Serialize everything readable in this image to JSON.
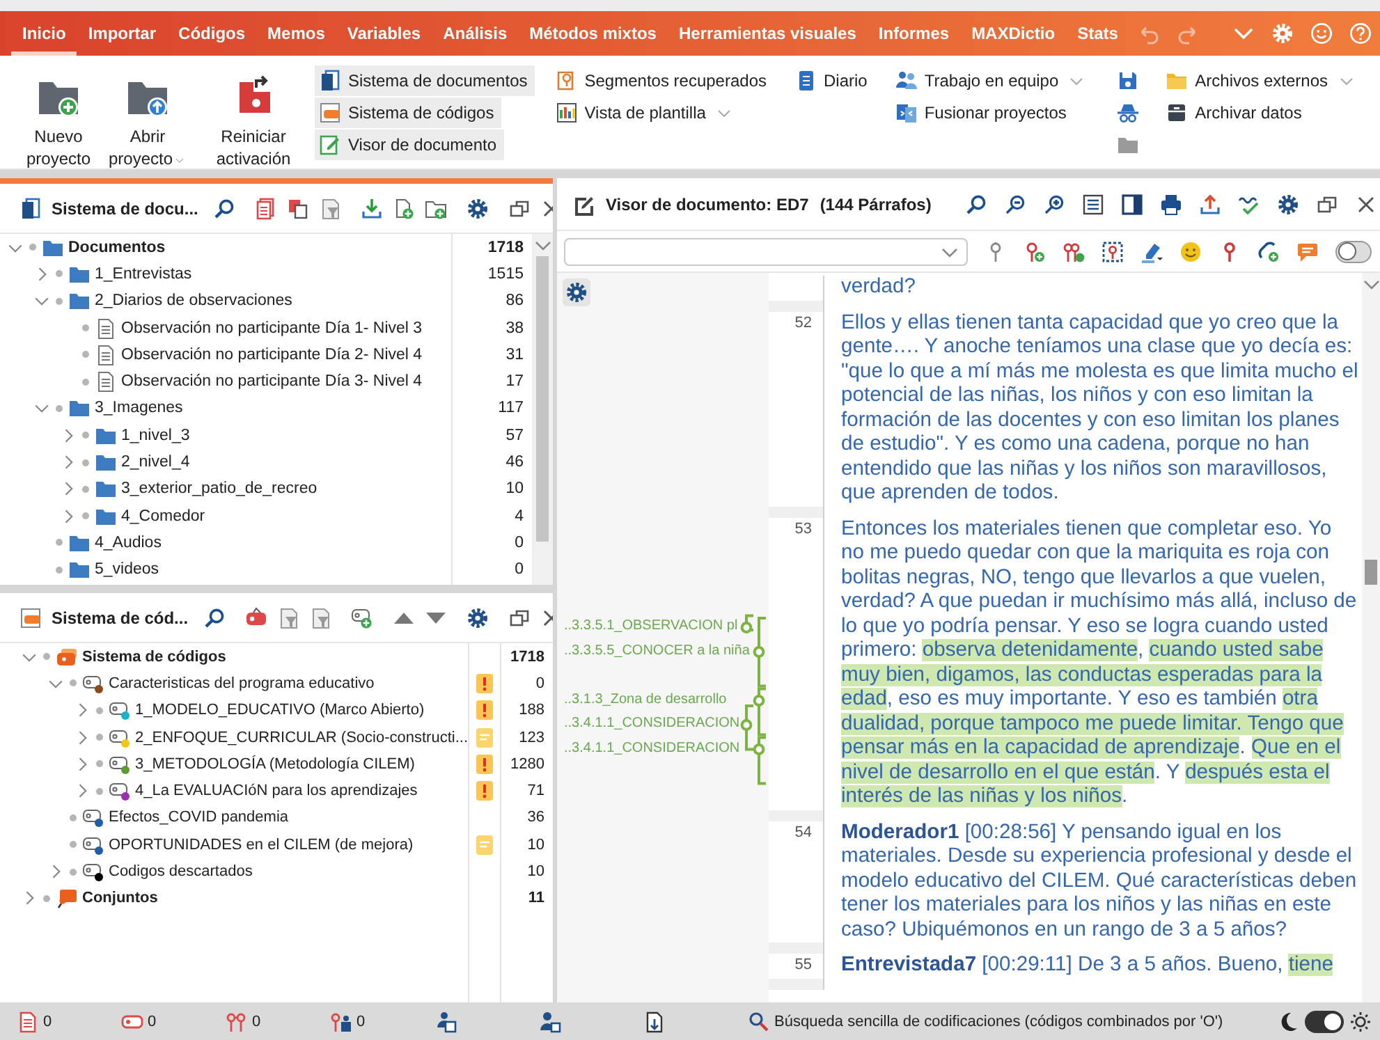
{
  "menu": {
    "tabs": [
      {
        "label": "Inicio",
        "selected": true
      },
      {
        "label": "Importar",
        "selected": false
      },
      {
        "label": "Códigos",
        "selected": false
      },
      {
        "label": "Memos",
        "selected": false
      },
      {
        "label": "Variables",
        "selected": false
      },
      {
        "label": "Análisis",
        "selected": false
      },
      {
        "label": "Métodos mixtos",
        "selected": false
      },
      {
        "label": "Herramientas visuales",
        "selected": false
      },
      {
        "label": "Informes",
        "selected": false
      },
      {
        "label": "MAXDictio",
        "selected": false
      },
      {
        "label": "Stats",
        "selected": false
      }
    ]
  },
  "ribbon": {
    "large_buttons": [
      {
        "label": "Nuevo proyecto",
        "dropdown": false
      },
      {
        "label": "Abrir proyecto",
        "dropdown": true
      },
      {
        "label": "Reiniciar activación",
        "dropdown": false
      }
    ],
    "groups": [
      {
        "kind": "list",
        "items": [
          {
            "label": "Sistema de documentos",
            "selected": true,
            "dropdown": false
          },
          {
            "label": "Sistema de códigos",
            "selected": true,
            "dropdown": false
          },
          {
            "label": "Visor de documento",
            "selected": true,
            "dropdown": false
          }
        ]
      },
      {
        "kind": "list",
        "items": [
          {
            "label": "Segmentos recuperados",
            "selected": false,
            "dropdown": false
          },
          {
            "label": "Vista de plantilla",
            "selected": false,
            "dropdown": true
          }
        ]
      },
      {
        "kind": "list",
        "items": [
          {
            "label": "Diario",
            "selected": false,
            "dropdown": false
          }
        ]
      },
      {
        "kind": "list",
        "items": [
          {
            "label": "Trabajo en equipo",
            "selected": false,
            "dropdown": true
          },
          {
            "label": "Fusionar proyectos",
            "selected": false,
            "dropdown": false
          }
        ]
      },
      {
        "kind": "icons"
      },
      {
        "kind": "list",
        "items": [
          {
            "label": "Archivos externos",
            "selected": false,
            "dropdown": true
          },
          {
            "label": "Archivar datos",
            "selected": false,
            "dropdown": false
          }
        ]
      }
    ]
  },
  "document_system": {
    "title": "Sistema de docu...",
    "items": [
      {
        "label": "Documentos",
        "count": "1718",
        "kind": "root",
        "expanded": true,
        "children": [
          {
            "label": "1_Entrevistas",
            "count": "1515",
            "kind": "folder",
            "expanded": false
          },
          {
            "label": "2_Diarios de observaciones",
            "count": "86",
            "kind": "folder",
            "expanded": true,
            "children": [
              {
                "label": "Observación no participante Día 1- Nivel 3",
                "count": "38",
                "kind": "document"
              },
              {
                "label": "Observación no participante Día 2- Nivel 4",
                "count": "31",
                "kind": "document"
              },
              {
                "label": "Observación no participante Día 3- Nivel 4",
                "count": "17",
                "kind": "document"
              }
            ]
          },
          {
            "label": "3_Imagenes",
            "count": "117",
            "kind": "folder",
            "expanded": true,
            "children": [
              {
                "label": "1_nivel_3",
                "count": "57",
                "kind": "folder",
                "expanded": false
              },
              {
                "label": "2_nivel_4",
                "count": "46",
                "kind": "folder",
                "expanded": false
              },
              {
                "label": "3_exterior_patio_de_recreo",
                "count": "10",
                "kind": "folder",
                "expanded": false
              },
              {
                "label": "4_Comedor",
                "count": "4",
                "kind": "folder",
                "expanded": false
              }
            ]
          },
          {
            "label": "4_Audios",
            "count": "0",
            "kind": "folder"
          },
          {
            "label": "5_videos",
            "count": "0",
            "kind": "folder"
          }
        ]
      }
    ]
  },
  "code_system": {
    "title": "Sistema de cód...",
    "items": [
      {
        "label": "Sistema de códigos",
        "count": "1718",
        "kind": "root",
        "expanded": true,
        "children": [
          {
            "label": "Caracteristicas del programa educativo",
            "count": "0",
            "kind": "code",
            "color": "#8b4a1c",
            "has_memo": true,
            "memo_flagged": true,
            "expanded": true,
            "children": [
              {
                "label": "1_MODELO_EDUCATIVO (Marco Abierto)",
                "count": "188",
                "kind": "code",
                "color": "#17b3c8",
                "has_memo": true,
                "memo_flagged": true,
                "expanded": false
              },
              {
                "label": "2_ENFOQUE_CURRICULAR (Socio-constructi...",
                "count": "123",
                "kind": "code",
                "color": "#f0c419",
                "has_memo": true,
                "memo_flagged": false,
                "expanded": false
              },
              {
                "label": "3_METODOLOGÍA (Metodología CILEM)",
                "count": "1280",
                "kind": "code",
                "color": "#5a9e2f",
                "has_memo": true,
                "memo_flagged": true,
                "expanded": false
              },
              {
                "label": "4_La EVALUACIóN para los aprendizajes",
                "count": "71",
                "kind": "code",
                "color": "#9b2fae",
                "has_memo": true,
                "memo_flagged": true,
                "expanded": false
              }
            ]
          },
          {
            "label": "Efectos_COVID pandemia",
            "count": "36",
            "kind": "code",
            "color": "#1f5fa8"
          },
          {
            "label": "OPORTUNIDADES en el CILEM (de mejora)",
            "count": "10",
            "kind": "code",
            "color": "#1f5fa8",
            "has_memo": true,
            "memo_flagged": false
          },
          {
            "label": "Codigos descartados",
            "count": "10",
            "kind": "code",
            "color": "#000000",
            "expanded": false
          }
        ]
      },
      {
        "label": "Conjuntos",
        "count": "11",
        "kind": "sets",
        "expanded": false
      }
    ]
  },
  "document_viewer": {
    "title": "Visor de documento: ED7",
    "paragraph_count": "(144 Párrafos)",
    "edit_mode": false,
    "paragraphs": [
      {
        "segments": [
          {
            "text": "verdad?",
            "coded": false
          }
        ]
      },
      {
        "number": "52",
        "segments": [
          {
            "text": "Ellos y ellas tienen tanta capacidad que yo creo que la gente…. Y anoche teníamos una clase que yo decía es: \"que lo que a mí más me molesta es que limita mucho el potencial de las niñas, los niños y con eso limitan la formación de las docentes y con eso limitan los planes de estudio\". Y es como una cadena, porque no han entendido que las niñas y los niños son maravillosos, que aprenden de todos.",
            "coded": false
          }
        ]
      },
      {
        "number": "53",
        "code_stripes": [
          {
            "label": "..3.3.5.1_OBSERVACION pl"
          },
          {
            "label": "..3.3.5.5_CONOCER a la niña"
          },
          {
            "label": "..3.1.3_Zona de desarrollo"
          },
          {
            "label": "..3.4.1.1_CONSIDERACION"
          },
          {
            "label": "..3.4.1.1_CONSIDERACION"
          }
        ],
        "segments": [
          {
            "text": "Entonces los materiales tienen que completar eso. Yo no me puedo quedar con que la mariquita es roja con bolitas negras, NO, tengo que llevarlos a que vuelen, verdad? A que puedan ir muchísimo más allá, incluso de lo que yo podría pensar. Y eso se logra cuando usted primero: ",
            "coded": false
          },
          {
            "text": "observa detenidamente",
            "coded": true
          },
          {
            "text": ", ",
            "coded": false
          },
          {
            "text": "cuando usted sabe muy bien, digamos, las conductas esperadas para la edad",
            "coded": true
          },
          {
            "text": ", eso es muy importante. Y eso es también ",
            "coded": false
          },
          {
            "text": "otra dualidad, porque tampoco me puede limitar. Tengo que pensar más en la capacidad de aprendizaje",
            "coded": true
          },
          {
            "text": ". ",
            "coded": false
          },
          {
            "text": "Que en el nivel de desarrollo en el que están",
            "coded": true
          },
          {
            "text": ". Y ",
            "coded": false
          },
          {
            "text": "después esta el interés de las niñas y los niños",
            "coded": true
          },
          {
            "text": ".",
            "coded": false
          }
        ]
      },
      {
        "number": "54",
        "speaker": "Moderador1",
        "segments": [
          {
            "text": "[00:28:56] Y pensando igual en los materiales. Desde su experiencia profesional y desde el modelo educativo del CILEM. Qué características deben tener los materiales para los niños y las niñas en este caso? Ubiquémonos en un rango de 3 a 5 años?",
            "coded": false
          }
        ]
      },
      {
        "number": "55",
        "speaker": "Entrevistada7",
        "segments": [
          {
            "text": "[00:29:11] De 3 a 5 años. Bueno, ",
            "coded": false
          },
          {
            "text": "tiene",
            "coded": true
          }
        ]
      }
    ]
  },
  "status_bar": {
    "light_mode": true,
    "counts": [
      "0",
      "0",
      "0",
      "0"
    ],
    "search_mode": "Búsqueda sencilla de codificaciones (códigos combinados por 'O')"
  }
}
